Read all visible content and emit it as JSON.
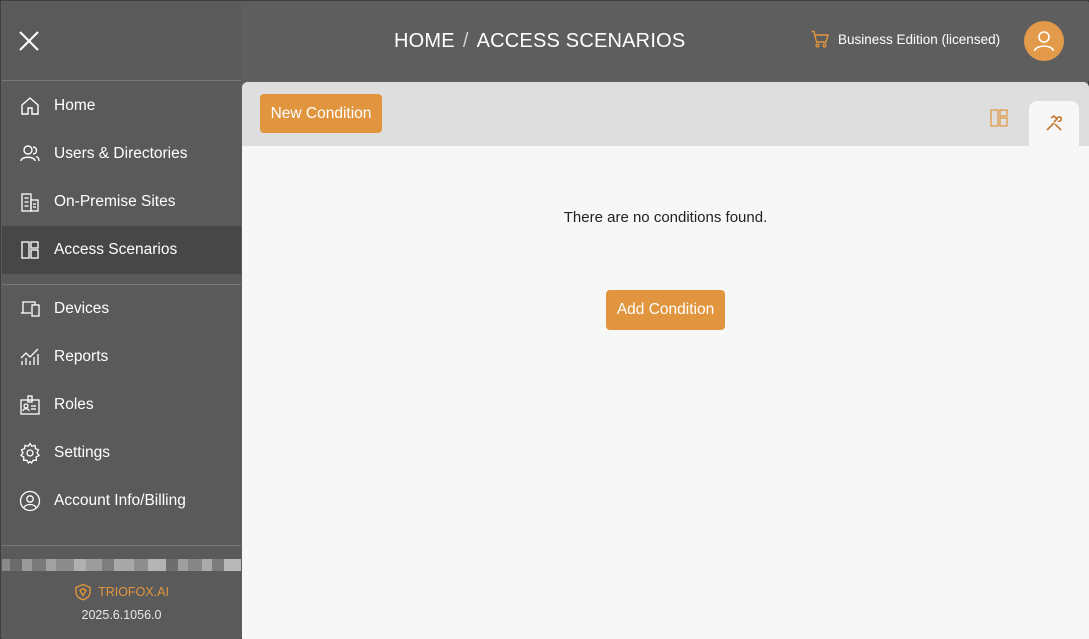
{
  "sidebar": {
    "items": [
      {
        "label": "Home",
        "icon": "home-icon"
      },
      {
        "label": "Users & Directories",
        "icon": "users-icon"
      },
      {
        "label": "On-Premise Sites",
        "icon": "building-icon"
      },
      {
        "label": "Access Scenarios",
        "icon": "layout-icon",
        "active": true
      },
      {
        "label": "Devices",
        "icon": "devices-icon"
      },
      {
        "label": "Reports",
        "icon": "chart-icon"
      },
      {
        "label": "Roles",
        "icon": "badge-icon"
      },
      {
        "label": "Settings",
        "icon": "gear-icon"
      },
      {
        "label": "Account Info/Billing",
        "icon": "account-icon"
      }
    ],
    "brand": "TRIOFOX.AI",
    "version": "2025.6.1056.0"
  },
  "header": {
    "breadcrumb_home": "HOME",
    "breadcrumb_sep": "/",
    "breadcrumb_current": "ACCESS SCENARIOS",
    "license_text": "Business Edition (licensed)"
  },
  "main": {
    "new_condition_label": "New Condition",
    "empty_message": "There are no conditions found.",
    "add_condition_label": "Add Condition"
  },
  "colors": {
    "accent": "#e0953e",
    "sidebar_bg": "#5a5a5a",
    "active_item_bg": "#474747",
    "toolbar_bg": "#dedede",
    "content_bg": "#f7f7f7"
  }
}
